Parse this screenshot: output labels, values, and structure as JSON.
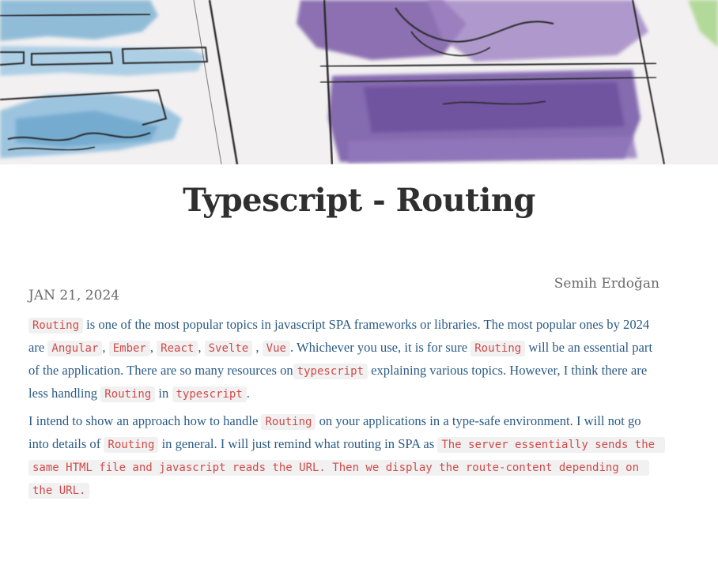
{
  "hero": {
    "icon": "watercolor-wireframe-illustration"
  },
  "post": {
    "title": "Typescript - Routing",
    "author": "Semih Erdoğan",
    "date": "JAN 21, 2024"
  },
  "body": {
    "p1": {
      "c1": "Routing",
      "t1": " is  one of the most popular topics in javascript SPA frameworks or libraries. The most popular ones by 2024 are ",
      "c2": "Angular",
      "t2": ", ",
      "c3": "Ember",
      "t3": ", ",
      "c4": "React",
      "t4": ", ",
      "c5": "Svelte",
      "t5": " , ",
      "c6": "Vue",
      "t6": ".  Whichever you use, it  is for sure ",
      "c7": "Routing",
      "t7": " will be an essential part of the application. There are so many resources on",
      "c8": "typescript",
      "t8": " explaining various topics. However, I think there are less handling ",
      "c9": "Routing",
      "t9": " in ",
      "c10": "typescript",
      "t10": "."
    },
    "p2": {
      "t1": "I intend to show an approach how to handle ",
      "c1": "Routing",
      "t2": " on your applications in a type-safe environment. I will not go into details of ",
      "c2": "Routing",
      "t3": " in general. I will just remind  what routing  in SPA as ",
      "c3": "The server essentially sends the same HTML file and javascript reads the URL. Then we display the route-content depending on the URL."
    }
  },
  "colors": {
    "text": "#2c5b86",
    "code": "#d14a4a",
    "code_bg": "#f1f1f1",
    "title": "#2f2f2f",
    "meta": "#6b6b6b"
  }
}
